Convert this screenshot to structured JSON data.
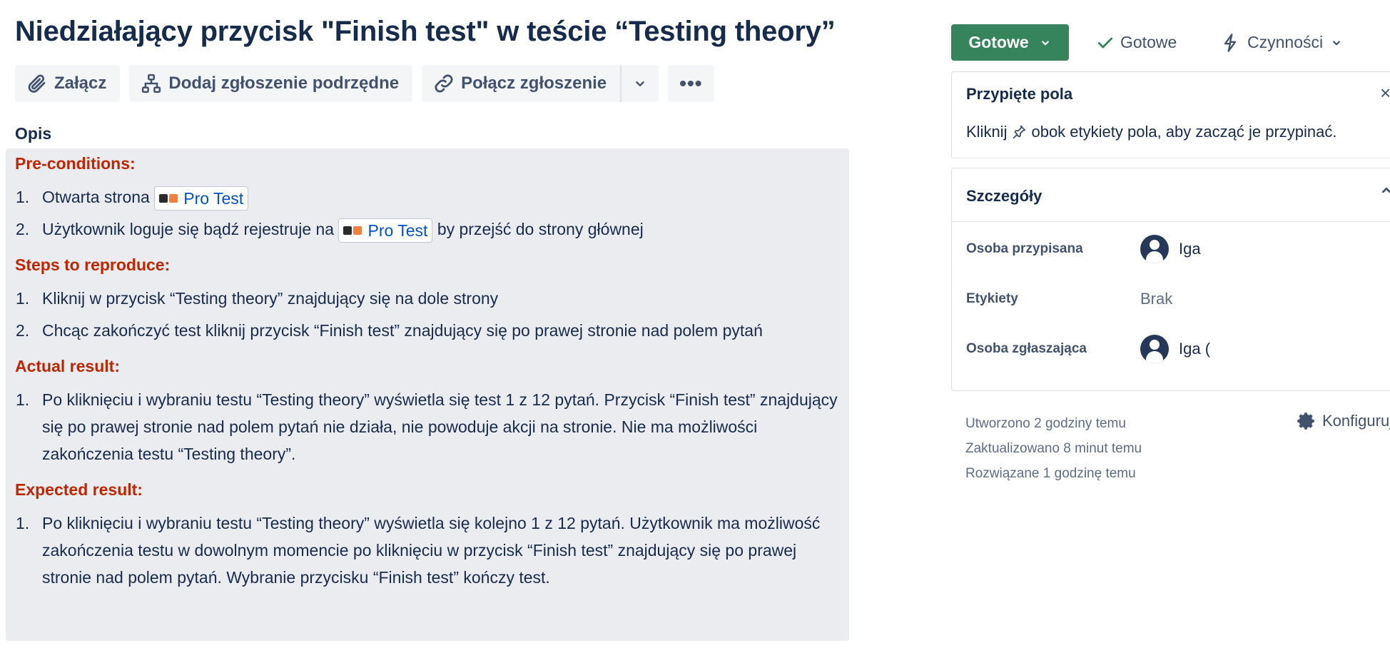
{
  "issue": {
    "title": "Niedziałający przycisk \"Finish test\" w teście “Testing theory”"
  },
  "toolbar": {
    "attach_label": "Załącz",
    "child_issue_label": "Dodaj zgłoszenie podrzędne",
    "link_issue_label": "Połącz zgłoszenie",
    "more_label": "•••"
  },
  "description": {
    "label": "Opis",
    "sections": [
      {
        "heading": "Pre-conditions:",
        "items": [
          {
            "num": "1.",
            "before": "Otwarta strona",
            "chip": "Pro Test",
            "after": ""
          },
          {
            "num": "2.",
            "before": "Użytkownik loguje się bądź rejestruje na",
            "chip": "Pro Test",
            "after": "by przejść do strony głównej"
          }
        ]
      },
      {
        "heading": "Steps to reproduce:",
        "items": [
          {
            "num": "1.",
            "text": "Kliknij w przycisk “Testing theory” znajdujący się na dole strony"
          },
          {
            "num": "2.",
            "text": "Chcąc zakończyć test kliknij przycisk “Finish test” znajdujący się po prawej stronie nad polem pytań"
          }
        ]
      },
      {
        "heading": "Actual result:",
        "items": [
          {
            "num": "1.",
            "text": "Po kliknięciu i wybraniu testu “Testing theory” wyświetla się test 1 z 12 pytań. Przycisk “Finish test” znajdujący się po prawej stronie nad polem pytań nie działa, nie powoduje akcji na stronie. Nie ma możliwości zakończenia testu “Testing theory”."
          }
        ]
      },
      {
        "heading": "Expected result:",
        "items": [
          {
            "num": "1.",
            "text": "Po kliknięciu i wybraniu testu “Testing theory” wyświetla się kolejno 1 z 12 pytań. Użytkownik ma możliwość zakończenia testu w dowolnym momencie po kliknięciu w przycisk “Finish test” znajdujący się po prawej stronie nad polem pytań. Wybranie przycisku “Finish test” kończy test."
          }
        ]
      }
    ]
  },
  "status": {
    "button_label": "Gotowe",
    "resolution_label": "Gotowe",
    "actions_label": "Czynności",
    "status_color": "#36845b"
  },
  "pinned": {
    "title": "Przypięte pola",
    "hint_before": "Kliknij",
    "hint_after": "obok etykiety pola, aby zacząć je przypinać."
  },
  "details": {
    "title": "Szczegóły",
    "assignee_label": "Osoba przypisana",
    "assignee_value": "Iga",
    "labels_label": "Etykiety",
    "labels_value": "Brak",
    "reporter_label": "Osoba zgłaszająca",
    "reporter_value": "Iga ("
  },
  "meta": {
    "created": "Utworzono 2 godziny temu",
    "updated": "Zaktualizowano 8 minut temu",
    "resolved": "Rozwiązane 1 godzinę temu",
    "configure_label": "Konfiguruj"
  },
  "icons": {
    "attach": "paperclip-icon",
    "child_issue": "hierarchy-icon",
    "link": "link-icon",
    "chevron": "chevron-down-icon",
    "more": "more-icon",
    "check": "check-icon",
    "actions": "lightning-icon",
    "pin": "pin-icon",
    "settings": "gear-icon"
  }
}
